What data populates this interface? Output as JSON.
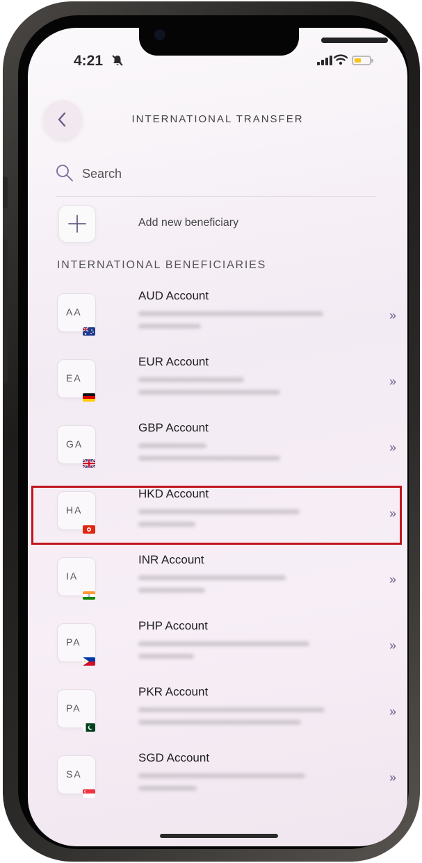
{
  "status_bar": {
    "time": "4:21"
  },
  "header": {
    "title": "INTERNATIONAL TRANSFER"
  },
  "search": {
    "placeholder": "Search"
  },
  "add_beneficiary": {
    "label": "Add new beneficiary"
  },
  "section": {
    "title": "INTERNATIONAL BENEFICIARIES"
  },
  "highlight_color": "#c0141c",
  "beneficiaries": [
    {
      "initials": "AA",
      "name": "AUD Account",
      "flag": "australia-flag-icon"
    },
    {
      "initials": "EA",
      "name": "EUR Account",
      "flag": "germany-flag-icon"
    },
    {
      "initials": "GA",
      "name": "GBP Account",
      "flag": "uk-flag-icon"
    },
    {
      "initials": "HA",
      "name": "HKD Account",
      "flag": "hong-kong-flag-icon",
      "highlighted": true
    },
    {
      "initials": "IA",
      "name": "INR Account",
      "flag": "india-flag-icon"
    },
    {
      "initials": "PA",
      "name": "PHP Account",
      "flag": "philippines-flag-icon"
    },
    {
      "initials": "PA",
      "name": "PKR Account",
      "flag": "pakistan-flag-icon"
    },
    {
      "initials": "SA",
      "name": "SGD Account",
      "flag": "singapore-flag-icon"
    }
  ]
}
